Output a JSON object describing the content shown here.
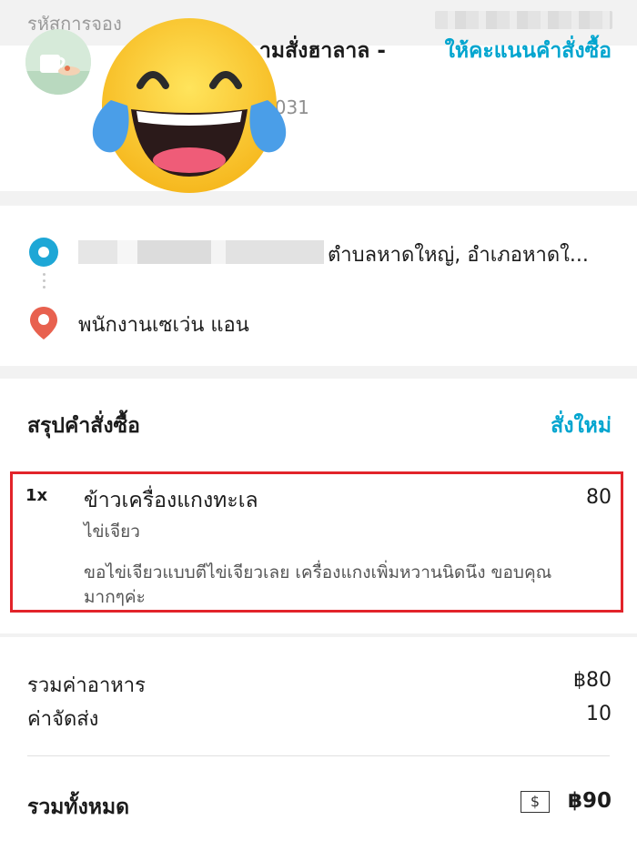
{
  "header": {
    "booking_label": "รหัสการจอง"
  },
  "store": {
    "name_visible": "ามสั่งฮาลาล -",
    "sub_visible": "F-031",
    "rate_label": "ให้คะแนนคำสั่งซื้อ"
  },
  "route": {
    "pickup_visible": "ตำบลหาดใหญ่, อำเภอหาดใ...",
    "dropoff": "พนักงานเซเว่น แอน"
  },
  "order": {
    "title": "สรุปคำสั่งซื้อ",
    "reorder_label": "สั่งใหม่",
    "item": {
      "qty": "1x",
      "name": "ข้าวเครื่องแกงทะเล",
      "option": "ไข่เจียว",
      "note": "ขอไข่เจียวแบบตีไข่เจียวเลย เครื่องแกงเพิ่มหวานนิดนึง ขอบคุณมากๆค่ะ",
      "price": "80"
    }
  },
  "totals": {
    "food_label": "รวมค่าอาหาร",
    "food_value": "฿80",
    "delivery_label": "ค่าจัดส่ง",
    "delivery_value": "10",
    "total_label": "รวมทั้งหมด",
    "payment_icon_glyph": "$",
    "total_value": "฿90"
  },
  "colors": {
    "accent": "#00a5cf",
    "highlight_border": "#e2242a",
    "pickup_dot": "#1ea7d6",
    "dropoff_pin": "#e8614f"
  },
  "icons": {
    "store": "store-avatar-icon",
    "pickup": "pickup-dot-icon",
    "dropoff": "location-pin-icon",
    "payment": "cash-icon",
    "overlay": "laughing-emoji"
  }
}
